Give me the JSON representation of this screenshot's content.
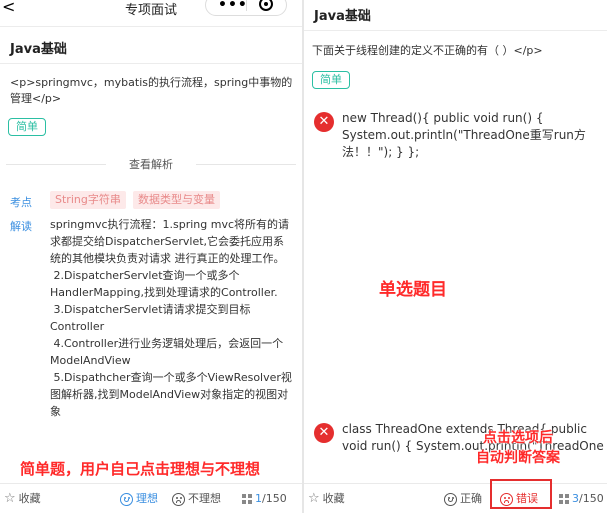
{
  "left": {
    "nav": {
      "back": "<",
      "title": "专项面试"
    },
    "section_title": "Java基础",
    "question": "<p>springmvc，mybatis的执行流程，spring中事物的管理</p>",
    "difficulty": "简单",
    "view_analysis": "查看解析",
    "knowledge_label": "考点",
    "knowledge_tags": [
      "String字符串",
      "数据类型与变量"
    ],
    "analysis_label": "解读",
    "analysis_paragraphs": [
      "springmvc执行流程：1.spring mvc将所有的请求都提交给DispatcherServlet,它会委托应用系统的其他模块负责对请求 进行真正的处理工作。",
      " 2.DispatcherServlet查询一个或多个HandlerMapping,找到处理请求的Controller.",
      " 3.DispatcherServlet请请求提交到目标Controller",
      " 4.Controller进行业务逻辑处理后，会返回一个ModelAndView",
      " 5.Dispathcher查询一个或多个ViewResolver视图解析器,找到ModelAndView对象指定的视图对象"
    ],
    "annotation": "简单题，用户自己点击理想与不理想",
    "bottom": {
      "favorite": "收藏",
      "ideal": "理想",
      "not_ideal": "不理想",
      "current": "1",
      "total": "/150"
    }
  },
  "right": {
    "section_title": "Java基础",
    "question": "下面关于线程创建的定义不正确的有（ ）</p>",
    "difficulty": "简单",
    "options": [
      "new Thread(){ public void run() { System.out.println(\"ThreadOne重写run方法！！\"); } };",
      "class ThreadOne extends Thread{ public void run() { System.out.println(\"ThreadOne"
    ],
    "annotation_center": "单选题目",
    "annotation_bottom": [
      "点击选项后",
      "自动判断答案"
    ],
    "bottom": {
      "favorite": "收藏",
      "correct": "正确",
      "wrong": "错误",
      "current": "3",
      "total": "/150"
    }
  },
  "colors": {
    "accent_green": "#2bbfa3",
    "accent_blue": "#3b8fe0",
    "error_red": "#e52e2e",
    "annotation_red": "#ff2a2a"
  }
}
